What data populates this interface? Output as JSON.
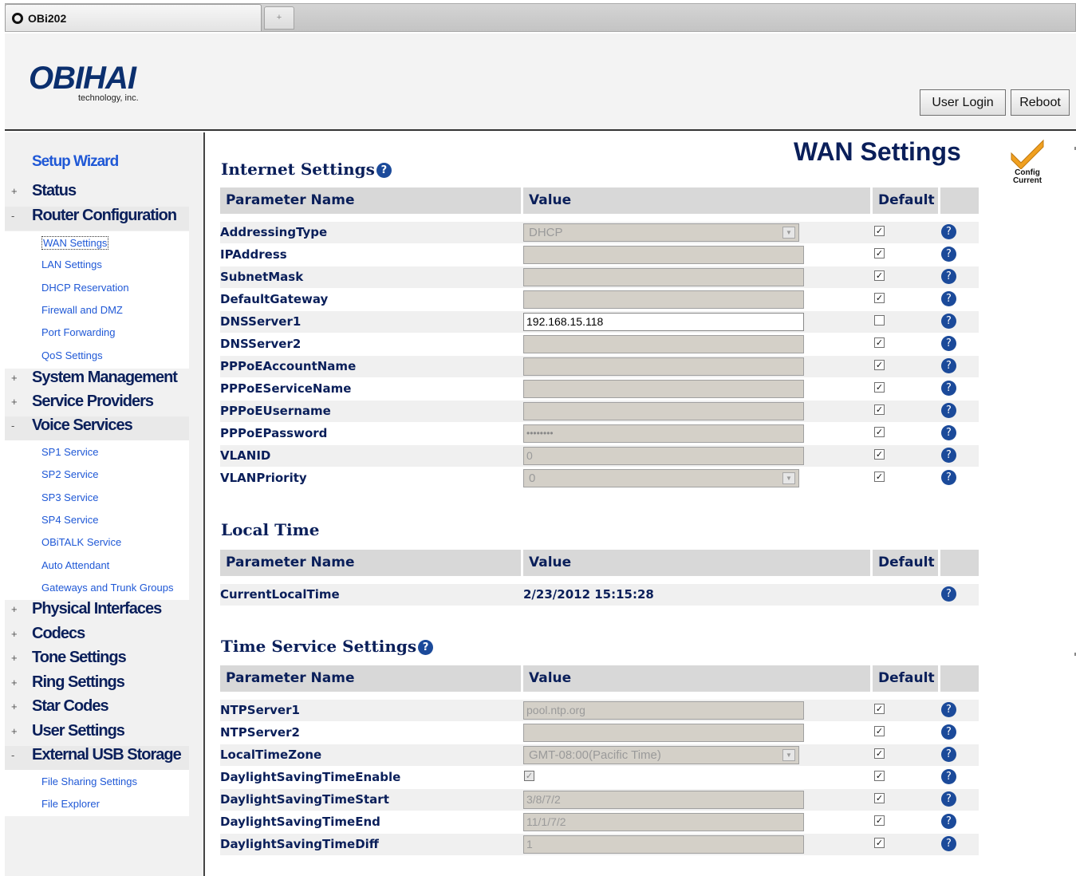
{
  "browser": {
    "tab_title": "OBi202",
    "new_tab_symbol": "+"
  },
  "header": {
    "logo": "OBIHAI",
    "logo_sub": "technology, inc.",
    "login_label": "User Login",
    "reboot_label": "Reboot"
  },
  "sidebar": {
    "setup_wizard": "Setup Wizard",
    "items": [
      {
        "label": "Status",
        "toggle": "+"
      },
      {
        "label": "Router Configuration",
        "toggle": "-",
        "children": [
          "WAN Settings",
          "LAN Settings",
          "DHCP Reservation",
          "Firewall and DMZ",
          "Port Forwarding",
          "QoS Settings"
        ]
      },
      {
        "label": "System Management",
        "toggle": "+"
      },
      {
        "label": "Service Providers",
        "toggle": "+"
      },
      {
        "label": "Voice Services",
        "toggle": "-",
        "children": [
          "SP1 Service",
          "SP2 Service",
          "SP3 Service",
          "SP4 Service",
          "OBiTALK Service",
          "Auto Attendant",
          "Gateways and Trunk Groups"
        ]
      },
      {
        "label": "Physical Interfaces",
        "toggle": "+"
      },
      {
        "label": "Codecs",
        "toggle": "+"
      },
      {
        "label": "Tone Settings",
        "toggle": "+"
      },
      {
        "label": "Ring Settings",
        "toggle": "+"
      },
      {
        "label": "Star Codes",
        "toggle": "+"
      },
      {
        "label": "User Settings",
        "toggle": "+"
      },
      {
        "label": "External USB Storage",
        "toggle": "-",
        "children": [
          "File Sharing Settings",
          "File Explorer"
        ]
      }
    ]
  },
  "main": {
    "page_title": "WAN Settings",
    "config_status": "Config Current",
    "columns": {
      "name": "Parameter Name",
      "value": "Value",
      "default": "Default"
    },
    "help_glyph": "?",
    "internet": {
      "title": "Internet Settings",
      "rows": [
        {
          "name": "AddressingType",
          "value": "DHCP",
          "type": "select",
          "default": true
        },
        {
          "name": "IPAddress",
          "value": "",
          "type": "text",
          "default": true
        },
        {
          "name": "SubnetMask",
          "value": "",
          "type": "text",
          "default": true
        },
        {
          "name": "DefaultGateway",
          "value": "",
          "type": "text",
          "default": true
        },
        {
          "name": "DNSServer1",
          "value": "192.168.15.118",
          "type": "text-active",
          "default": false
        },
        {
          "name": "DNSServer2",
          "value": "",
          "type": "text",
          "default": true
        },
        {
          "name": "PPPoEAccountName",
          "value": "",
          "type": "text",
          "default": true
        },
        {
          "name": "PPPoEServiceName",
          "value": "",
          "type": "text",
          "default": true
        },
        {
          "name": "PPPoEUsername",
          "value": "",
          "type": "text",
          "default": true
        },
        {
          "name": "PPPoEPassword",
          "value": "••••••••",
          "type": "password",
          "default": true
        },
        {
          "name": "VLANID",
          "value": "0",
          "type": "text",
          "default": true
        },
        {
          "name": "VLANPriority",
          "value": "0",
          "type": "select",
          "default": true
        }
      ]
    },
    "local_time": {
      "title": "Local Time",
      "rows": [
        {
          "name": "CurrentLocalTime",
          "value": "2/23/2012 15:15:28"
        }
      ]
    },
    "time_service": {
      "title": "Time Service Settings",
      "rows": [
        {
          "name": "NTPServer1",
          "value": "pool.ntp.org",
          "type": "text",
          "default": true
        },
        {
          "name": "NTPServer2",
          "value": "",
          "type": "text",
          "default": true
        },
        {
          "name": "LocalTimeZone",
          "value": "GMT-08:00(Pacific Time)",
          "type": "select",
          "default": true
        },
        {
          "name": "DaylightSavingTimeEnable",
          "value": "checked",
          "type": "checkbox",
          "default": true
        },
        {
          "name": "DaylightSavingTimeStart",
          "value": "3/8/7/2",
          "type": "text",
          "default": true
        },
        {
          "name": "DaylightSavingTimeEnd",
          "value": "11/1/7/2",
          "type": "text",
          "default": true
        },
        {
          "name": "DaylightSavingTimeDiff",
          "value": "1",
          "type": "text",
          "default": true
        }
      ]
    }
  },
  "colors": {
    "nav_link": "#1f58d6",
    "heading": "#0a1f5a",
    "config_check": "#f0a020"
  }
}
